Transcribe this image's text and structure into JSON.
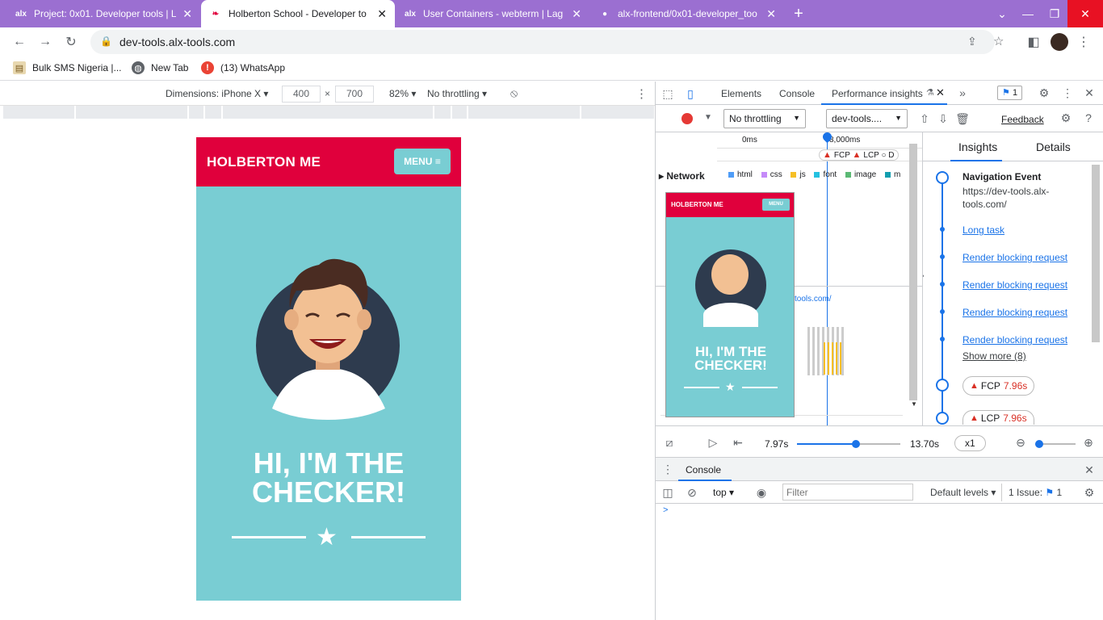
{
  "tabs": [
    {
      "favicon": "alx",
      "title": "Project: 0x01. Developer tools | L"
    },
    {
      "favicon": "holberton",
      "title": "Holberton School - Developer to"
    },
    {
      "favicon": "alx",
      "title": "User Containers - webterm | Lag"
    },
    {
      "favicon": "github",
      "title": "alx-frontend/0x01-developer_too"
    }
  ],
  "url": "dev-tools.alx-tools.com",
  "bookmarks": [
    {
      "icon": "sms-icon",
      "label": "Bulk SMS Nigeria |..."
    },
    {
      "icon": "globe-icon",
      "label": "New Tab"
    },
    {
      "icon": "whatsapp-icon",
      "label": "(13) WhatsApp"
    }
  ],
  "device_toolbar": {
    "dimensions": "Dimensions: iPhone X",
    "width": "400",
    "height": "700",
    "times": "×",
    "zoom": "82%",
    "throttling": "No throttling"
  },
  "page": {
    "logo": "HOLBERTON ME",
    "menu": "MENU",
    "hero_line1": "HI, I'M THE",
    "hero_line2": "CHECKER!"
  },
  "devtools": {
    "tabs": [
      "Elements",
      "Console",
      "Performance insights"
    ],
    "issues_badge": "1",
    "throttling": "No throttling",
    "target": "dev-tools....",
    "feedback": "Feedback",
    "timeline_start": "0ms",
    "timeline_mark": "8,000ms",
    "markers": [
      "FCP",
      "LCP",
      "D"
    ],
    "network_label": "Network",
    "legend": [
      "html",
      "css",
      "js",
      "font",
      "image",
      "m"
    ],
    "url_fragment": "tools.com/",
    "insights_tab": "Insights",
    "details_tab": "Details",
    "nav_event_title": "Navigation Event",
    "nav_event_url": "https://dev-tools.alx-tools.com/",
    "insight_links": [
      "Long task",
      "Render blocking request",
      "Render blocking request",
      "Render blocking request",
      "Render blocking request"
    ],
    "show_more": "Show more (8)",
    "fcp": {
      "label": "FCP",
      "value": "7.96s"
    },
    "lcp": {
      "label": "LCP",
      "value": "7.96s"
    },
    "playback_current": "7.97s",
    "playback_end": "13.70s",
    "playback_speed": "x1",
    "playback_progress": 0.57,
    "console_tab": "Console",
    "console_context": "top",
    "console_filter_placeholder": "Filter",
    "console_levels": "Default levels",
    "console_issues": "1 Issue:",
    "console_issues_count": "1",
    "console_prompt": ">"
  },
  "thumbnail": {
    "logo": "HOLBERTON ME",
    "menu": "MENU",
    "hero": "HI, I'M THE CHECKER!"
  },
  "colors": {
    "tabstrip": "#9b6fd1",
    "brand_red": "#e0003c",
    "teal": "#79cdd3",
    "accent_blue": "#1a73e8"
  }
}
